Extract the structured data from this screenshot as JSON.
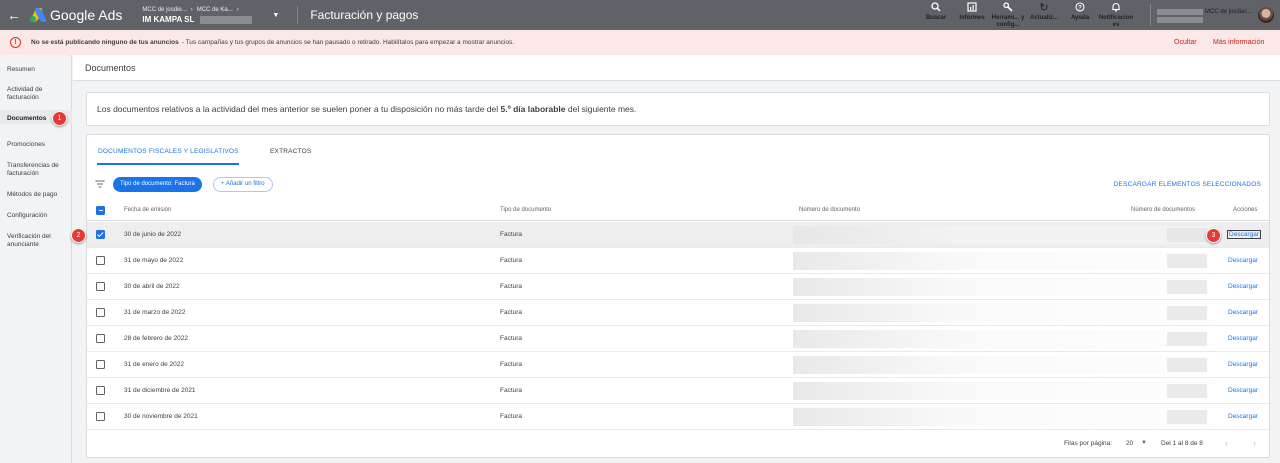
{
  "topbar": {
    "app_name": "Google Ads",
    "breadcrumb": [
      "MCC de josdie...",
      "MCC de Ka..."
    ],
    "account_name": "IM KAMPA SL",
    "page_title": "Facturación y pagos",
    "actions": [
      {
        "icon": "search-icon",
        "label": "Buscar"
      },
      {
        "icon": "reports-icon",
        "label": "Informes"
      },
      {
        "icon": "wrench-icon",
        "label": "Herrami... y config..."
      },
      {
        "icon": "refresh-icon",
        "label": "Actualiz..."
      },
      {
        "icon": "help-icon",
        "label": "Ayuda"
      },
      {
        "icon": "bell-icon",
        "label": "Notificacion es"
      }
    ],
    "user_account": "MCC de josdiac..."
  },
  "alert": {
    "strong": "No se está publicando ninguno de tus anuncios",
    "text": "- Tus campañas y tus grupos de anuncios se han pausado o retirado. Habilítalos para empezar a mostrar anuncios.",
    "hide": "Ocultar",
    "more": "Más información"
  },
  "sidebar": {
    "items": [
      "Resumen",
      "Actividad de facturación",
      "Documentos",
      "Promociones",
      "Transferencias de facturación",
      "Métodos de pago",
      "Configuración",
      "Verificación del anunciante"
    ],
    "active": "Documentos"
  },
  "main": {
    "title": "Documentos",
    "notice_pre": "Los documentos relativos a la actividad del mes anterior se suelen poner a tu disposición no más tarde del ",
    "notice_bold": "5.º día laborable",
    "notice_post": " del siguiente mes."
  },
  "tabs": [
    "DOCUMENTOS FISCALES Y LEGISLATIVOS",
    "EXTRACTOS"
  ],
  "filters": {
    "active_chip": "Tipo de documento: Factura",
    "add_filter": "+ Añadir un filtro",
    "download_selected": "DESCARGAR ELEMENTOS SELECCIONADOS"
  },
  "table": {
    "headers": [
      "Fecha de emisión",
      "Tipo de documento",
      "Número de documento",
      "Número de documentos",
      "Acciones"
    ],
    "rows": [
      {
        "date": "30 de junio de 2022",
        "type": "Factura",
        "action": "Descargar"
      },
      {
        "date": "31 de mayo de 2022",
        "type": "Factura",
        "action": "Descargar"
      },
      {
        "date": "30 de abril de 2022",
        "type": "Factura",
        "action": "Descargar"
      },
      {
        "date": "31 de marzo de 2022",
        "type": "Factura",
        "action": "Descargar"
      },
      {
        "date": "28 de febrero de 2022",
        "type": "Factura",
        "action": "Descargar"
      },
      {
        "date": "31 de enero de 2022",
        "type": "Factura",
        "action": "Descargar"
      },
      {
        "date": "31 de diciembre de 2021",
        "type": "Factura",
        "action": "Descargar"
      },
      {
        "date": "30 de noviembre de 2021",
        "type": "Factura",
        "action": "Descargar"
      }
    ]
  },
  "footer": {
    "rows_label": "Filas por página:",
    "rows_value": "20",
    "range": "Del 1 al 8 de 8"
  },
  "markers": [
    "1",
    "2",
    "3"
  ],
  "colors": {
    "accent": "#1a73e8",
    "topbar": "#5f6368",
    "alert_bg": "#fce8e6",
    "marker": "#e53935"
  }
}
